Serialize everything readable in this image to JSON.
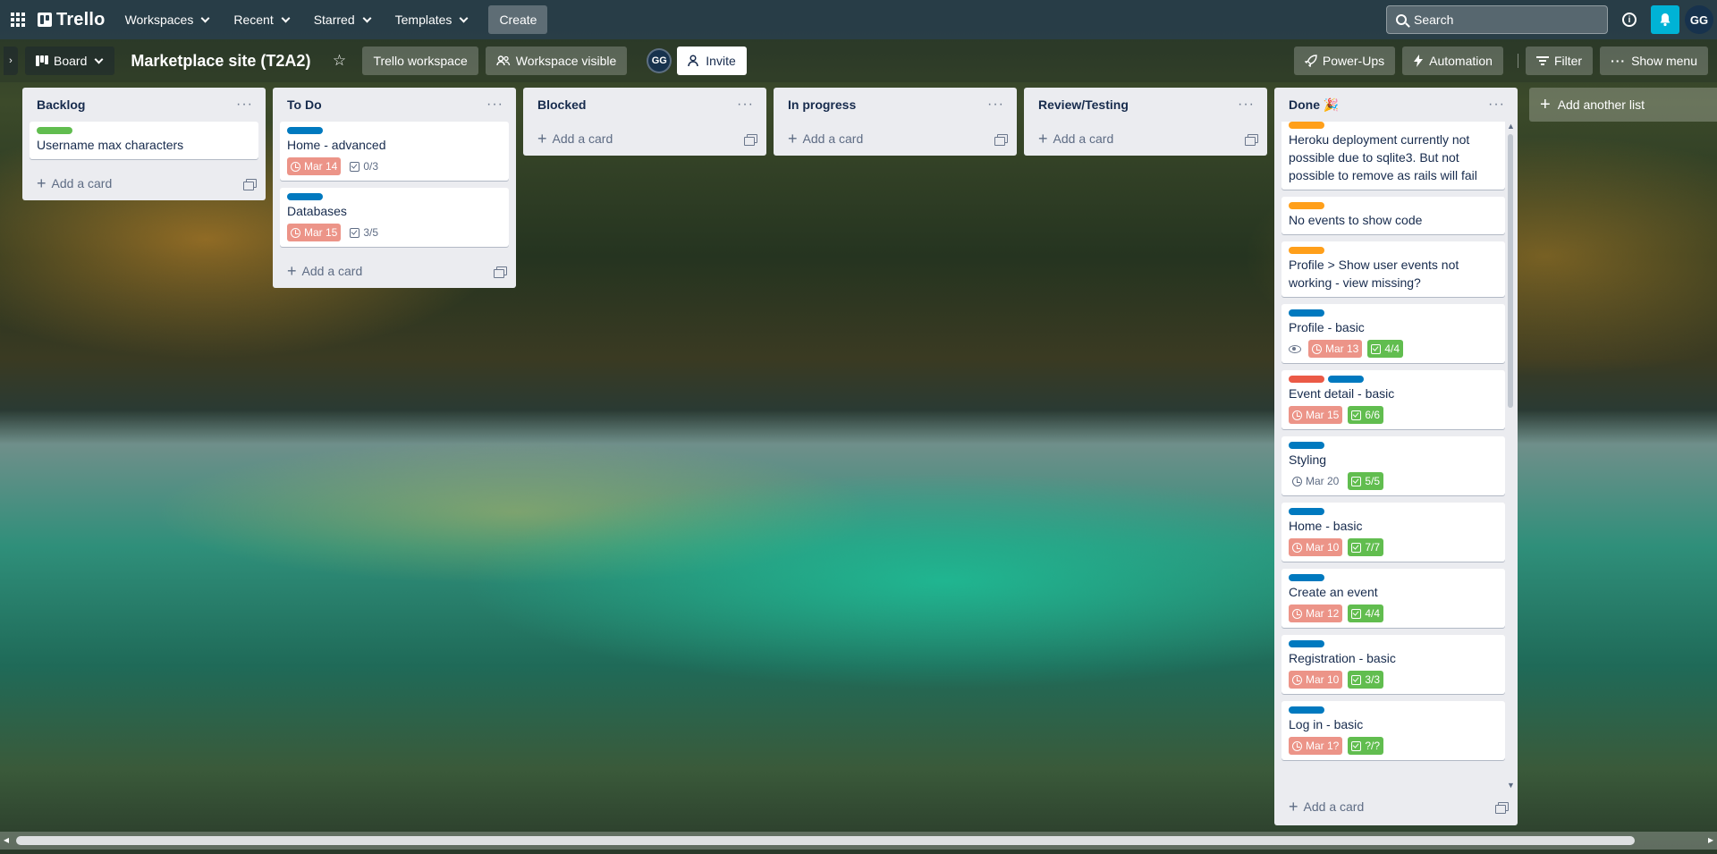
{
  "topbar": {
    "logo": "Trello",
    "nav": [
      "Workspaces",
      "Recent",
      "Starred",
      "Templates"
    ],
    "create_label": "Create",
    "search_placeholder": "Search",
    "avatar_initials": "GG",
    "notification_color": "#00b3d6"
  },
  "board": {
    "view_label": "Board",
    "title": "Marketplace site (T2A2)",
    "workspace_label": "Trello workspace",
    "visibility_label": "Workspace visible",
    "member_initials": "GG",
    "invite_label": "Invite",
    "powerups_label": "Power-Ups",
    "automation_label": "Automation",
    "filter_label": "Filter",
    "menu_label": "Show menu"
  },
  "lists": [
    {
      "title": "Backlog",
      "add_label": "Add a card",
      "cards": [
        {
          "labels": [
            "#61bd4f"
          ],
          "title": "Username max characters"
        }
      ]
    },
    {
      "title": "To Do",
      "add_label": "Add a card",
      "cards": [
        {
          "labels": [
            "#0079bf"
          ],
          "title": "Home - advanced",
          "due": "Mar 14",
          "checklist": "0/3"
        },
        {
          "labels": [
            "#0079bf"
          ],
          "title": "Databases",
          "due": "Mar 15",
          "checklist": "3/5"
        }
      ]
    },
    {
      "title": "Blocked",
      "add_label": "Add a card",
      "cards": []
    },
    {
      "title": "In progress",
      "add_label": "Add a card",
      "cards": []
    },
    {
      "title": "Review/Testing",
      "add_label": "Add a card",
      "cards": []
    },
    {
      "title": "Done 🎉",
      "add_label": "Add a card",
      "cards": [
        {
          "labels": [
            "#ff9f1a"
          ],
          "title": "Heroku deployment currently not possible due to sqlite3. But not possible to remove as rails will fail"
        },
        {
          "labels": [
            "#ff9f1a"
          ],
          "title": "No events to show code"
        },
        {
          "labels": [
            "#ff9f1a"
          ],
          "title": "Profile > Show user events not working - view missing?"
        },
        {
          "labels": [
            "#0079bf"
          ],
          "title": "Profile - basic",
          "watch": true,
          "due": "Mar 13",
          "checklist": "4/4"
        },
        {
          "labels": [
            "#eb5a46",
            "#0079bf"
          ],
          "title": "Event detail - basic",
          "due": "Mar 15",
          "checklist": "6/6"
        },
        {
          "labels": [
            "#0079bf"
          ],
          "title": "Styling",
          "due": "Mar 20",
          "checklist": "5/5"
        },
        {
          "labels": [
            "#0079bf"
          ],
          "title": "Home - basic",
          "due": "Mar 10",
          "checklist": "7/7"
        },
        {
          "labels": [
            "#0079bf"
          ],
          "title": "Create an event",
          "due": "Mar 12",
          "checklist": "4/4"
        },
        {
          "labels": [
            "#0079bf"
          ],
          "title": "Registration - basic",
          "due": "Mar 10",
          "checklist": "3/3"
        },
        {
          "labels": [
            "#0079bf"
          ],
          "title": "Log in - basic",
          "due": "Mar 1?",
          "checklist": "?/?"
        }
      ]
    }
  ],
  "add_list_label": "Add another list"
}
